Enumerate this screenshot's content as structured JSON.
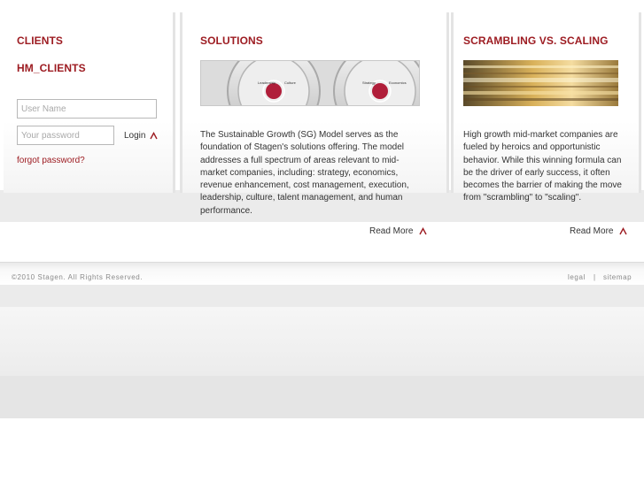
{
  "clients": {
    "heading": "CLIENTS",
    "subheading": "HM_CLIENTS",
    "username_placeholder": "User Name",
    "password_placeholder": "Your password",
    "login_label": "Login",
    "forgot_label": "forgot password?"
  },
  "solutions": {
    "heading": "SOLUTIONS",
    "image_labels": [
      "Leadership",
      "Culture",
      "Strategy",
      "Economics"
    ],
    "body": "The Sustainable Growth (SG) Model serves as the foundation of Stagen's solutions offering. The model addresses a full spectrum of areas relevant to mid-market companies, including: strategy, economics, revenue enhancement, cost management, execution, leadership, culture, talent management, and human performance.",
    "read_more_label": "Read More"
  },
  "scaling": {
    "heading": "SCRAMBLING VS. SCALING",
    "body": "High growth mid-market companies are fueled by heroics and opportunistic behavior. While this winning formula can be the driver of early success, it often becomes the barrier of making the move from \"scrambling\" to \"scaling\".",
    "read_more_label": "Read More"
  },
  "footer": {
    "copyright": "©2010 Stagen. All Rights Reserved.",
    "legal_label": "legal",
    "separator": "|",
    "sitemap_label": "sitemap"
  },
  "colors": {
    "accent": "#9d1c22",
    "text": "#333333",
    "muted": "#8a8a8a"
  },
  "icons": {
    "login_icon": "caret-up-icon",
    "read_more_icon": "caret-up-icon"
  }
}
